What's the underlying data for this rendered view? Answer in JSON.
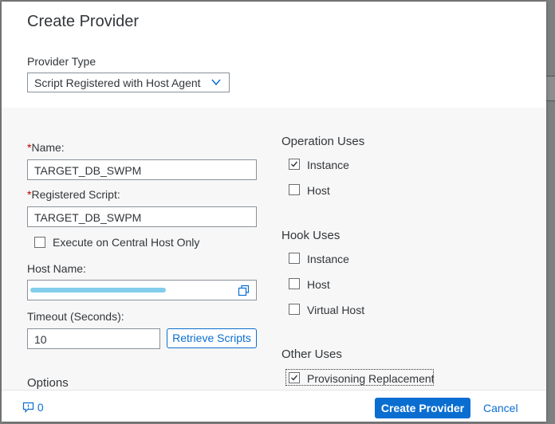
{
  "dialog": {
    "title": "Create Provider",
    "provider_type": {
      "label": "Provider Type",
      "value": "Script Registered with Host Agent"
    },
    "name": {
      "label": "Name:",
      "value": "TARGET_DB_SWPM"
    },
    "registered_script": {
      "label": "Registered Script:",
      "value": "TARGET_DB_SWPM"
    },
    "execute_central": {
      "label": "Execute on Central Host Only",
      "checked": false
    },
    "host_name": {
      "label": "Host Name:",
      "value": ""
    },
    "timeout": {
      "label": "Timeout (Seconds):",
      "value": "10"
    },
    "retrieve_label": "Retrieve Scripts",
    "options_heading": "Options",
    "operation_uses": {
      "heading": "Operation Uses",
      "items": [
        {
          "label": "Instance",
          "checked": true
        },
        {
          "label": "Host",
          "checked": false
        }
      ]
    },
    "hook_uses": {
      "heading": "Hook Uses",
      "items": [
        {
          "label": "Instance",
          "checked": false
        },
        {
          "label": "Host",
          "checked": false
        },
        {
          "label": "Virtual Host",
          "checked": false
        }
      ]
    },
    "other_uses": {
      "heading": "Other Uses",
      "items": [
        {
          "label": "Provisoning Replacement",
          "checked": true
        }
      ]
    }
  },
  "footer": {
    "message_count": "0",
    "create_label": "Create Provider",
    "cancel_label": "Cancel"
  },
  "colors": {
    "accent": "#0a6ed1",
    "required": "#bb0000"
  }
}
